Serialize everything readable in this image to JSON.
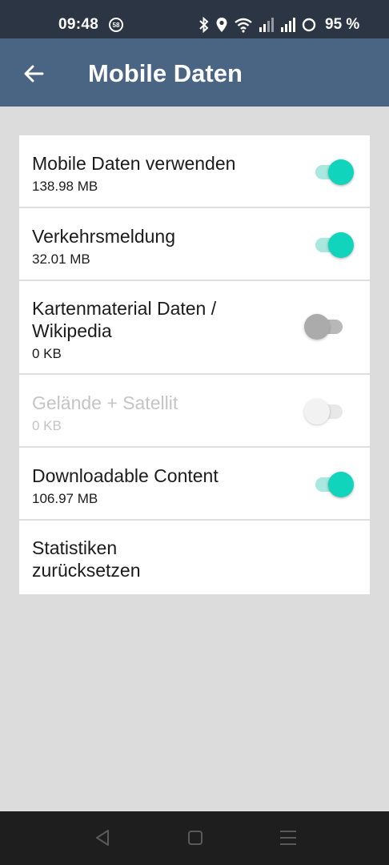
{
  "status_bar": {
    "time": "09:48",
    "notification_badge": "58",
    "icons": [
      "bluetooth-icon",
      "location-icon",
      "wifi-icon",
      "signal-icon",
      "signal-icon",
      "battery-ring-icon"
    ],
    "battery": "95 %"
  },
  "app_bar": {
    "back_icon": "arrow-left-icon",
    "title": "Mobile Daten"
  },
  "settings": [
    {
      "title": "Mobile Daten verwenden",
      "subtitle": "138.98 MB",
      "toggle": "on",
      "enabled": true
    },
    {
      "title": "Verkehrsmeldung",
      "subtitle": "32.01 MB",
      "toggle": "on",
      "enabled": true
    },
    {
      "title": "Kartenmaterial Daten /",
      "title_line2": "Wikipedia",
      "subtitle": "0 KB",
      "toggle": "off",
      "enabled": true
    },
    {
      "title": "Gelände + Satellit",
      "subtitle": "0 KB",
      "toggle": "off",
      "enabled": false
    },
    {
      "title": "Downloadable Content",
      "subtitle": "106.97 MB",
      "toggle": "on",
      "enabled": true
    },
    {
      "title": "Statistiken",
      "title_line2": "zurücksetzen"
    }
  ],
  "colors": {
    "status_bar": "#2b3544",
    "app_bar": "#4a6484",
    "background": "#dcdcdc",
    "toggle_on_thumb": "#10d4bc",
    "toggle_on_track": "#a8e8de",
    "nav_bar": "#1e1e1e"
  },
  "nav_bar": {
    "icons": [
      "back-triangle-icon",
      "home-square-icon",
      "recents-menu-icon"
    ]
  }
}
